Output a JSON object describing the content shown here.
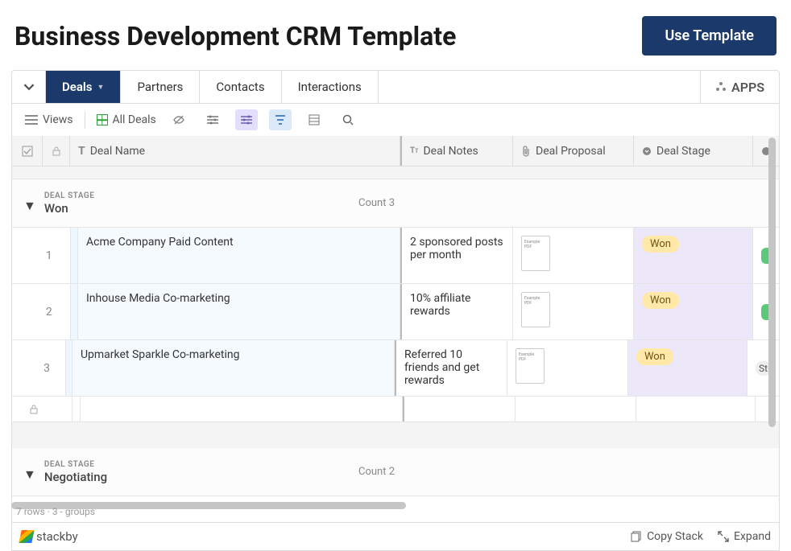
{
  "header": {
    "title": "Business Development CRM Template",
    "use_template": "Use Template"
  },
  "tabs": {
    "items": [
      "Deals",
      "Partners",
      "Contacts",
      "Interactions"
    ],
    "apps": "APPS"
  },
  "toolbar": {
    "views": "Views",
    "all_deals": "All Deals"
  },
  "columns": {
    "name": "Deal Name",
    "notes": "Deal Notes",
    "proposal": "Deal Proposal",
    "stage": "Deal Stage"
  },
  "groups": [
    {
      "label": "DEAL STAGE",
      "value": "Won",
      "count_label": "Count",
      "count": "3",
      "rows": [
        {
          "num": "1",
          "name": "Acme Company Paid Content",
          "notes": "2 sponsored posts per month",
          "doc": "Example PDF",
          "stage": "Won",
          "tail": ""
        },
        {
          "num": "2",
          "name": "Inhouse Media Co-marketing",
          "notes": "10% affiliate rewards",
          "doc": "Example PDF",
          "stage": "Won",
          "tail": ""
        },
        {
          "num": "3",
          "name": "Upmarket Sparkle Co-marketing",
          "notes": "Referred 10 friends and get rewards",
          "doc": "Example PDF",
          "stage": "Won",
          "tail": "St"
        }
      ]
    },
    {
      "label": "DEAL STAGE",
      "value": "Negotiating",
      "count_label": "Count",
      "count": "2",
      "rows": []
    }
  ],
  "status": "7 rows · 3 - groups",
  "footer": {
    "brand": "stackby",
    "copy": "Copy Stack",
    "expand": "Expand"
  }
}
